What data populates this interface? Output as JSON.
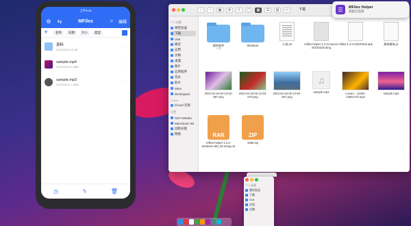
{
  "phone": {
    "status": {
      "left": "",
      "center": "上午9:41",
      "right": ""
    },
    "header": {
      "title": "MFiles",
      "settings_icon": "gear-icon",
      "transfer_icon": "transfer-icon",
      "search_icon": "search-icon",
      "edit_label": "编辑"
    },
    "sortbar": {
      "plus": "+",
      "items": [
        "名称",
        "日期",
        "大小",
        "类型"
      ]
    },
    "files": [
      {
        "name": "资料",
        "sub": "2022/04/16 10:48",
        "kind": "folder"
      },
      {
        "name": "sample.mp4",
        "sub": "2022/04/16 1.6MB",
        "kind": "video"
      },
      {
        "name": "sample.mp3",
        "sub": "2022/04/16 1.6MB",
        "kind": "audio"
      }
    ],
    "tabs": [
      "clock-icon",
      "bolt-icon",
      "trash-icon"
    ]
  },
  "finder": {
    "title": "下载",
    "sidebar": {
      "favorites_label": "个人收藏",
      "favorites": [
        "隔空投送",
        "下载",
        "Vivit",
        "最近",
        "应用",
        "文稿",
        "桌面",
        "图片",
        "应用程序",
        "音乐",
        "影片",
        "Sites",
        "Workspace"
      ],
      "icloud_label": "iCloud",
      "icloud": [
        "iCloud 云盘"
      ],
      "locations_label": "位置",
      "locations": [
        "Xie's MacBo",
        "Macintosh HD",
        "远程光盘",
        "网络"
      ]
    },
    "items": [
      {
        "name": "我的软件",
        "sub": "3 项",
        "kind": "folder"
      },
      {
        "name": "Windows",
        "sub": "",
        "kind": "folder"
      },
      {
        "name": "小说.txt",
        "sub": "",
        "kind": "text"
      },
      {
        "name": "mfiles-helper-1.2.0-macos-20220228.dmg",
        "sub": "",
        "kind": "dmg"
      },
      {
        "name": "mfiles-1.2.0-20220315.apk",
        "sub": "",
        "kind": "apk"
      },
      {
        "name": "脚本解析.js",
        "sub": "",
        "kind": "js"
      },
      {
        "name": "2022-04-16-02-12-52-897.png",
        "sub": "",
        "kind": "photo1"
      },
      {
        "name": "2022-04-16-02-12-53-670.png",
        "sub": "",
        "kind": "photo2"
      },
      {
        "name": "2022-04-16-02-12-52-567.png",
        "sub": "",
        "kind": "photo3"
      },
      {
        "name": "sample.mp3",
        "sub": "",
        "kind": "music"
      },
      {
        "name": "Lovoro - 12481-1280x720.mp4",
        "sub": "",
        "kind": "video1"
      },
      {
        "name": "sample.mp4",
        "sub": "",
        "kind": "video2"
      },
      {
        "name": "mfiles-helper-1.2.0-windows-x86_64-setup.rar",
        "sub": "",
        "kind": "rar",
        "label": "RAR"
      },
      {
        "name": "3385.zip",
        "sub": "",
        "kind": "zip",
        "label": "ZIP"
      }
    ]
  },
  "notification": {
    "title": "MFiles Helper",
    "subtitle": "链接已连接",
    "icon": "mfiles-helper-icon"
  },
  "finder2": {
    "items": [
      "个人收藏",
      "隔空投送",
      "下载",
      "Vivit",
      "应用",
      "文稿"
    ]
  }
}
